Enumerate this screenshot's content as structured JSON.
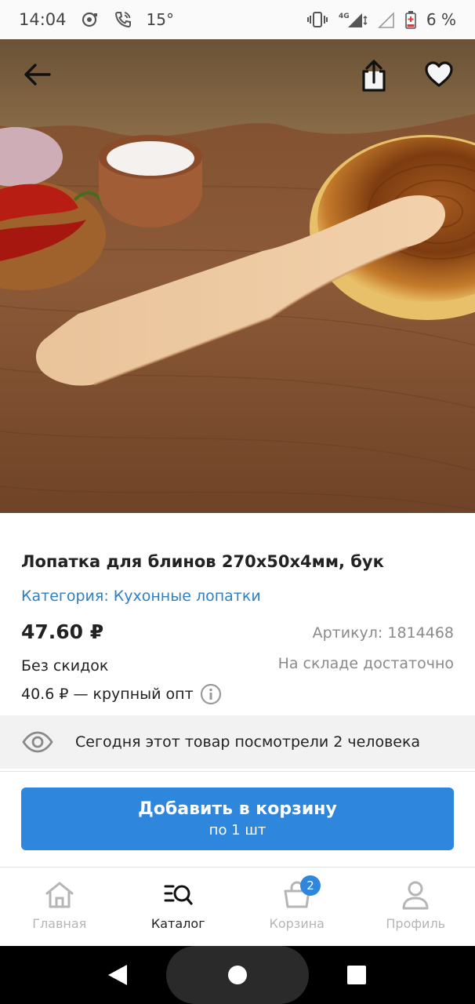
{
  "status_bar": {
    "time": "14:04",
    "temperature": "15°",
    "network": "4G",
    "battery": "6 %"
  },
  "hero": {
    "back_icon": "arrow-left-icon",
    "share_icon": "share-icon",
    "favorite_icon": "heart-icon"
  },
  "product": {
    "title": "Лопатка для блинов 270х50х4мм, бук",
    "category": "Категория: Кухонные лопатки",
    "price": "47.60 ₽",
    "article": "Артикул: 1814468",
    "discount": "Без скидок",
    "stock": "На складе достаточно",
    "wholesale": "40.6 ₽ — крупный опт"
  },
  "viewers": {
    "text": "Сегодня этот товар посмотрели 2 человека"
  },
  "cart_button": {
    "label": "Добавить в корзину",
    "sublabel": "по 1 шт"
  },
  "bottom_nav": {
    "items": [
      {
        "label": "Главная",
        "icon": "home-icon"
      },
      {
        "label": "Каталог",
        "icon": "catalog-search-icon"
      },
      {
        "label": "Корзина",
        "icon": "basket-icon",
        "badge": "2"
      },
      {
        "label": "Профиль",
        "icon": "user-icon"
      }
    ]
  },
  "colors": {
    "accent": "#2f86dd",
    "link": "#2f7fc1"
  }
}
